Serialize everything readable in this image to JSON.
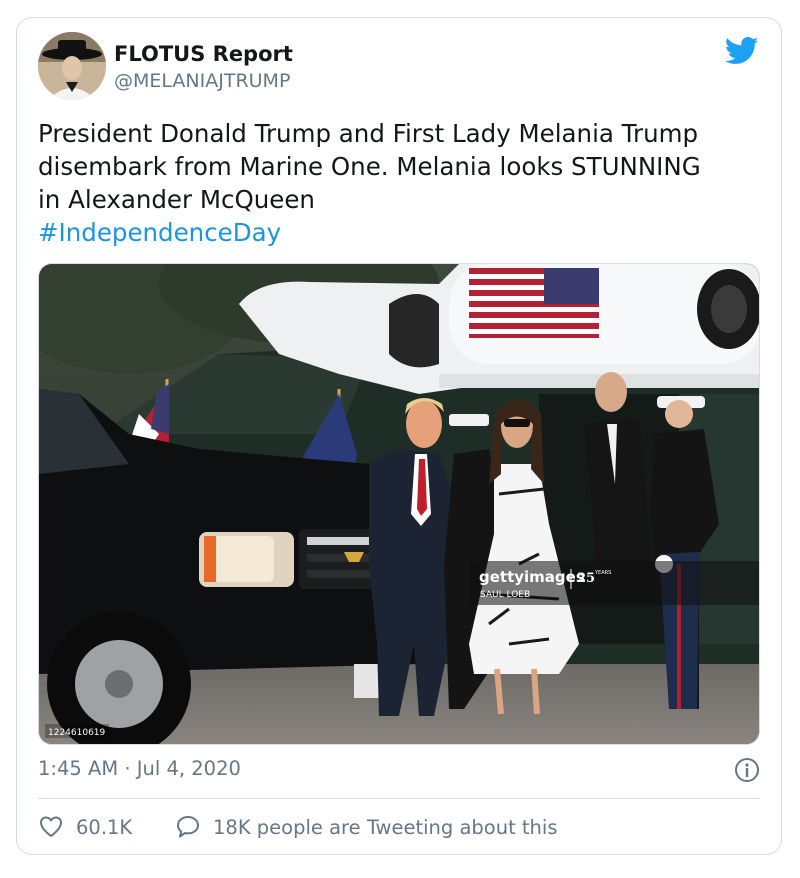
{
  "tweet": {
    "author": {
      "name": "FLOTUS Report",
      "handle": "@MELANIAJTRUMP"
    },
    "text_lines": [
      "President Donald Trump and First Lady Melania Trump",
      "disembark from Marine One. Melania looks STUNNING",
      "in Alexander McQueen"
    ],
    "hashtag": "#IndependenceDay",
    "media": {
      "watermark_brand": "gettyimages",
      "watermark_badge": "25",
      "watermark_badge_sub": "YEARS",
      "watermark_credit": "SAUL LOEB",
      "image_number": "1224610619"
    },
    "timestamp": "1:45 AM · Jul 4, 2020",
    "likes": "60.1K",
    "tweeting_about": "18K people are Tweeting about this"
  },
  "colors": {
    "accent": "#1da1f2",
    "hashtag": "#1b95e0",
    "secondary_text": "#657786",
    "border": "#d4dde3"
  },
  "icons": {
    "brand": "twitter-bird-icon",
    "info": "info-icon",
    "like": "heart-icon",
    "reply": "speech-bubble-icon"
  }
}
